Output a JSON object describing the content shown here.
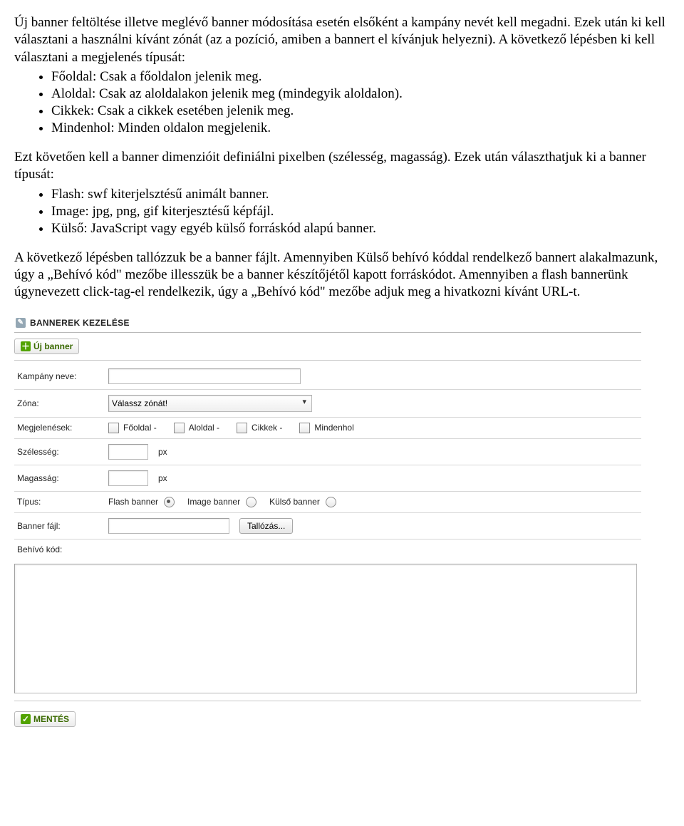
{
  "doc": {
    "p1": "Új banner feltöltése illetve meglévő banner módosítása esetén elsőként a kampány nevét kell megadni. Ezek után ki kell választani a használni kívánt zónát (az a pozíció, amiben a bannert el kívánjuk helyezni). A következő lépésben ki kell választani a megjelenés típusát:",
    "list1": [
      "Főoldal: Csak a főoldalon jelenik meg.",
      "Aloldal: Csak az aloldalakon jelenik meg (mindegyik aloldalon).",
      "Cikkek: Csak a cikkek esetében jelenik meg.",
      "Mindenhol: Minden oldalon megjelenik."
    ],
    "p2": "Ezt követően kell a banner dimenzióit definiálni pixelben (szélesség, magasság). Ezek után választhatjuk ki a banner típusát:",
    "list2": [
      "Flash: swf kiterjelsztésű animált banner.",
      "Image: jpg, png, gif kiterjesztésű képfájl.",
      "Külső: JavaScript vagy egyéb külső forráskód alapú banner."
    ],
    "p3": "A következő lépésben tallózzuk be a banner fájlt. Amennyiben Külső behívó kóddal rendelkező bannert alakalmazunk, úgy a „Behívó kód\" mezőbe illesszük be a banner készítőjétől kapott forráskódot. Amennyiben a flash bannerünk úgynevezett click-tag-el rendelkezik, úgy a „Behívó kód\" mezőbe adjuk meg a hivatkozni kívánt URL-t."
  },
  "form": {
    "panel_title": "BANNEREK KEZELÉSE",
    "new_button": "Új banner",
    "save_button": "MENTÉS",
    "labels": {
      "campaign": "Kampány neve:",
      "zone": "Zóna:",
      "appearances": "Megjelenések:",
      "width": "Szélesség:",
      "height": "Magasság:",
      "type": "Típus:",
      "file": "Banner fájl:",
      "code": "Behívó kód:"
    },
    "zone_placeholder": "Válassz zónát!",
    "unit": "px",
    "appearance_options": {
      "fooldal": "Főoldal -",
      "aloldal": "Aloldal -",
      "cikkek": "Cikkek -",
      "mindenhol": "Mindenhol"
    },
    "type_options": {
      "flash": "Flash banner",
      "image": "Image banner",
      "kulso": "Külső banner"
    },
    "browse_button": "Tallózás..."
  }
}
